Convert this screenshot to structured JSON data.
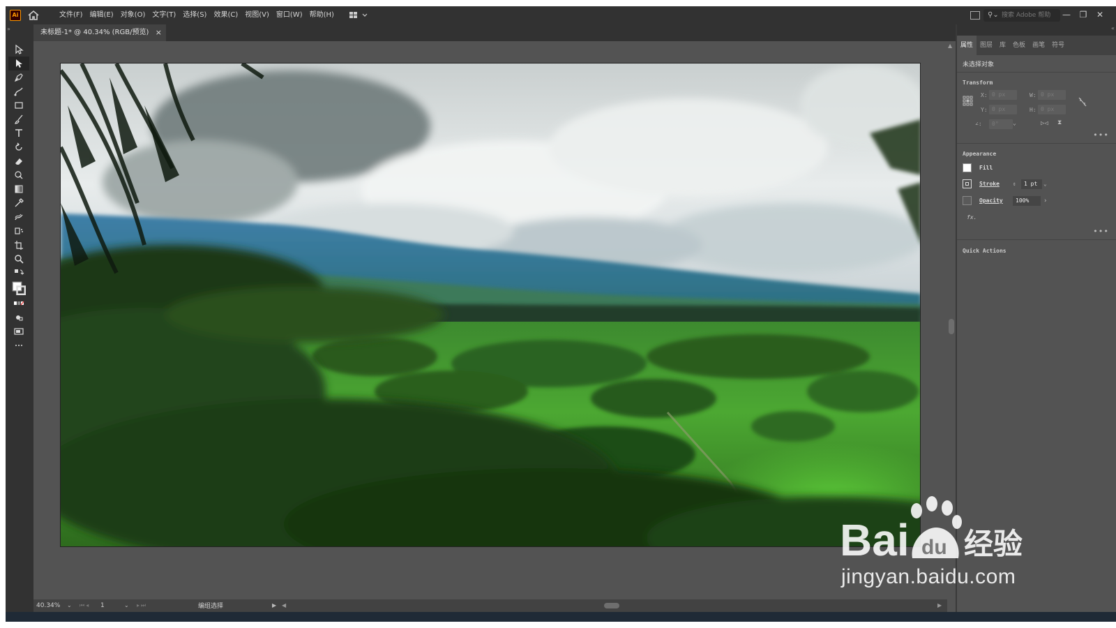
{
  "app": {
    "logo_text": "Ai",
    "menu": [
      "文件(F)",
      "编辑(E)",
      "对象(O)",
      "文字(T)",
      "选择(S)",
      "效果(C)",
      "视图(V)",
      "窗口(W)",
      "帮助(H)"
    ],
    "search_placeholder": "搜索 Adobe 帮助",
    "window_controls": {
      "minimize": "—",
      "restore": "❐",
      "close": "✕"
    }
  },
  "document": {
    "tab_title": "未标题-1* @ 40.34% (RGB/预览)",
    "close_glyph": "×"
  },
  "status": {
    "zoom": "40.34%",
    "artboard": "1",
    "tool_text": "编组选择"
  },
  "properties": {
    "tabs": [
      "属性",
      "图层",
      "库",
      "色板",
      "画笔",
      "符号"
    ],
    "active_tab": "属性",
    "no_selection": "未选择对象",
    "transform": {
      "title": "Transform",
      "x_label": "X:",
      "x_value": "0 px",
      "y_label": "Y:",
      "y_value": "0 px",
      "w_label": "W:",
      "w_value": "0 px",
      "h_label": "H:",
      "h_value": "0 px",
      "angle_value": "0°"
    },
    "appearance": {
      "title": "Appearance",
      "fill_label": "Fill",
      "stroke_label": "Stroke",
      "stroke_weight": "1 pt",
      "opacity_label": "Opacity",
      "opacity_value": "100%",
      "fx_label": "fx."
    },
    "quick_actions_title": "Quick Actions"
  },
  "watermark": {
    "brand_text": "Bai",
    "brand_cn": "经验",
    "url": "jingyan.baidu.com"
  },
  "colors": {
    "chrome_dark": "#323232",
    "workspace": "#535353",
    "logo_orange": "#ff9a00",
    "taskbar": "#1f2a36"
  }
}
